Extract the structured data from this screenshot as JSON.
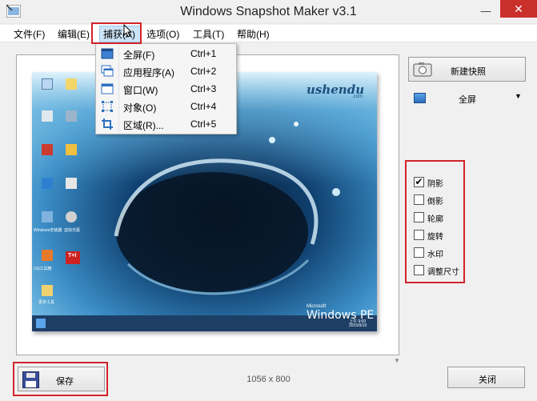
{
  "window": {
    "title": "Windows Snapshot Maker v3.1",
    "controls": {
      "minimize": "—",
      "close": "✕"
    }
  },
  "menu": {
    "items": [
      "文件(F)",
      "编辑(E)",
      "捕获(A)",
      "选项(O)",
      "工具(T)",
      "帮助(H)"
    ],
    "active_index": 2
  },
  "capture_menu": {
    "items": [
      {
        "label": "全屏(F)",
        "shortcut": "Ctrl+1",
        "icon": "fullscreen-icon"
      },
      {
        "label": "应用程序(A)",
        "shortcut": "Ctrl+2",
        "icon": "application-icon"
      },
      {
        "label": "窗口(W)",
        "shortcut": "Ctrl+3",
        "icon": "window-icon"
      },
      {
        "label": "对象(O)",
        "shortcut": "Ctrl+4",
        "icon": "object-icon"
      },
      {
        "label": "区域(R)...",
        "shortcut": "Ctrl+5",
        "icon": "region-icon"
      }
    ]
  },
  "right_panel": {
    "new_snapshot_label": "新建快照",
    "mode": {
      "value": "全屏",
      "icon": "fullscreen-icon"
    },
    "options": [
      {
        "label": "阴影",
        "checked": true
      },
      {
        "label": "倒影",
        "checked": false
      },
      {
        "label": "轮廓",
        "checked": false
      },
      {
        "label": "旋转",
        "checked": false
      },
      {
        "label": "水印",
        "checked": false
      },
      {
        "label": "调整尺寸",
        "checked": false
      }
    ]
  },
  "preview": {
    "logo": "ushendu",
    "logo_sub": ".com",
    "brand_small": "Microsoft",
    "brand": "Windows PE",
    "clock": {
      "time": "上午 9:00",
      "date": "2015/9/10"
    },
    "desktop_icons": [
      "此电脑",
      "网络",
      "回收站",
      "宽带连接",
      "DiskGenius分区工具",
      "系统备份还原",
      "Windows安装器",
      "虚拟光驱",
      "UQ工具箱",
      "CGI备份还原",
      "更多工具",
      "T+I"
    ]
  },
  "bottom": {
    "save_label": "保存",
    "dimensions": "1056 x 800",
    "close_label": "关闭"
  },
  "colors": {
    "highlight_box": "#d2232a",
    "menu_hover": "#cce4f7",
    "close_button": "#c9302c"
  }
}
